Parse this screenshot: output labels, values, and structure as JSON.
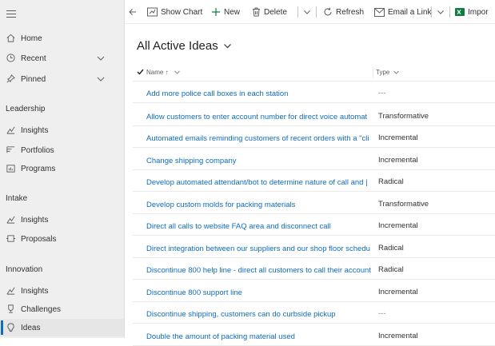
{
  "sidebar": {
    "top_items": [
      {
        "label": "Home"
      },
      {
        "label": "Recent"
      },
      {
        "label": "Pinned"
      }
    ],
    "sections": [
      {
        "title": "Leadership",
        "items": [
          {
            "label": "Insights"
          },
          {
            "label": "Portfolios"
          },
          {
            "label": "Programs"
          }
        ]
      },
      {
        "title": "Intake",
        "items": [
          {
            "label": "Insights"
          },
          {
            "label": "Proposals"
          }
        ]
      },
      {
        "title": "Innovation",
        "items": [
          {
            "label": "Insights"
          },
          {
            "label": "Challenges"
          },
          {
            "label": "Ideas"
          }
        ]
      }
    ],
    "active_item": "Ideas"
  },
  "commandbar": {
    "show_chart": "Show Chart",
    "new": "New",
    "delete": "Delete",
    "refresh": "Refresh",
    "email_link": "Email a Link",
    "import": "Impor"
  },
  "view": {
    "title": "All Active Ideas"
  },
  "grid": {
    "columns": {
      "name": "Name ↑",
      "type": "Type"
    },
    "rows": [
      {
        "name": "Add more police call boxes in each station",
        "type": "---"
      },
      {
        "name": "Allow customers to enter account number for direct voice automat",
        "type": "Transformative"
      },
      {
        "name": "Automated emails reminding customers of recent orders with a \"cli",
        "type": "Incremental"
      },
      {
        "name": "Change shipping company",
        "type": "Incremental"
      },
      {
        "name": "Develop automated attendant/bot to determine nature of call and |",
        "type": "Radical"
      },
      {
        "name": "Develop custom molds for packing materials",
        "type": "Transformative"
      },
      {
        "name": "Direct all calls to website FAQ area and disconnect call",
        "type": "Incremental"
      },
      {
        "name": "Direct integration between our suppliers and our shop floor schedu",
        "type": "Radical"
      },
      {
        "name": "Discontinue 800 help line - direct all customers to call their account",
        "type": "Radical"
      },
      {
        "name": "Discontinue 800 support line",
        "type": "Incremental"
      },
      {
        "name": "Discontinue shipping, customers can do curbside pickup",
        "type": "---"
      },
      {
        "name": "Double the amount of packing material used",
        "type": "Incremental"
      }
    ]
  },
  "colors": {
    "accent": "#0f6cbd",
    "sidebar_bg": "#efefef",
    "excel_green": "#107c41"
  }
}
